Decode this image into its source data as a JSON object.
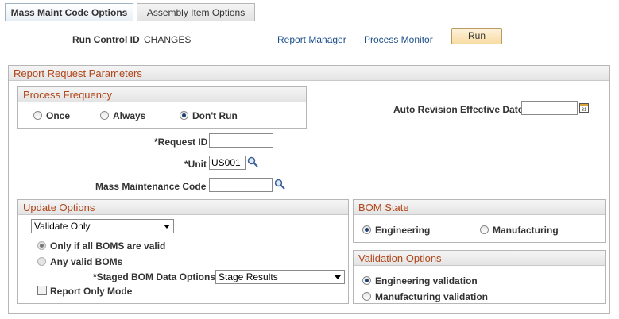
{
  "tabs": {
    "active": "Mass Maint Code Options",
    "inactive": "Assembly Item Options"
  },
  "header": {
    "run_control_label": "Run Control ID",
    "run_control_value": "CHANGES",
    "report_manager": "Report Manager",
    "process_monitor": "Process Monitor",
    "run_button": "Run"
  },
  "report_params": {
    "title": "Report Request Parameters",
    "process_frequency": {
      "title": "Process Frequency",
      "options": [
        "Once",
        "Always",
        "Don't Run"
      ],
      "selected": "Don't Run"
    },
    "auto_revision_label": "Auto Revision Effective Date",
    "auto_revision_value": "",
    "request_id_label": "*Request ID",
    "request_id_value": "",
    "unit_label": "*Unit",
    "unit_value": "US001",
    "mass_code_label": "Mass Maintenance Code",
    "mass_code_value": ""
  },
  "update_options": {
    "title": "Update Options",
    "select_value": "Validate Only",
    "radio_only_valid": "Only if all BOMS are valid",
    "radio_any_valid": "Any valid BOMs",
    "staged_label": "*Staged BOM Data Options",
    "staged_value": "Stage Results",
    "report_only_label": "Report Only Mode"
  },
  "bom_state": {
    "title": "BOM State",
    "options": [
      "Engineering",
      "Manufacturing"
    ],
    "selected": "Engineering"
  },
  "validation_options": {
    "title": "Validation Options",
    "options": [
      "Engineering validation",
      "Manufacturing validation"
    ],
    "selected": "Engineering validation"
  },
  "icons": {
    "lookup": "magnifier-icon",
    "calendar": "calendar-icon"
  },
  "colors": {
    "group_title": "#b0461a",
    "link": "#1b4f8a",
    "button": "#f8dca3"
  }
}
